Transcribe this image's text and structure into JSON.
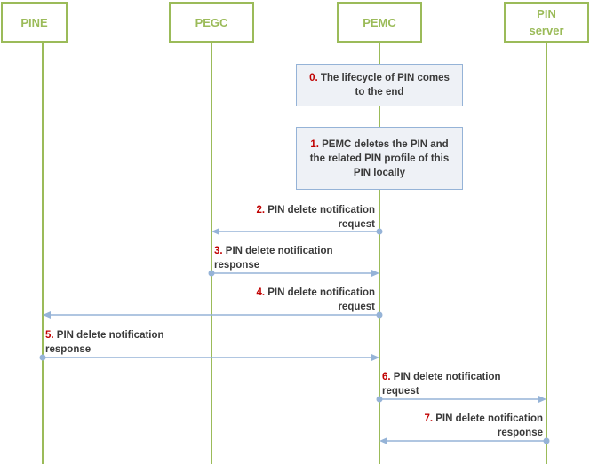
{
  "entities": [
    {
      "name": "PINE"
    },
    {
      "name": "PEGC"
    },
    {
      "name": "PEMC"
    },
    {
      "name": "PIN\nserver"
    }
  ],
  "notes": [
    {
      "num": "0.",
      "text": " The lifecycle of PIN comes to the end"
    },
    {
      "num": "1.",
      "text": " PEMC deletes the PIN and the related PIN profile of this PIN locally"
    }
  ],
  "messages": [
    {
      "num": "2.",
      "line1": " PIN delete notification",
      "line2": "request",
      "from": "PEMC",
      "to": "PEGC"
    },
    {
      "num": "3.",
      "line1": " PIN delete notification",
      "line2": "response",
      "from": "PEGC",
      "to": "PEMC"
    },
    {
      "num": "4.",
      "line1": " PIN delete notification",
      "line2": "request",
      "from": "PEMC",
      "to": "PINE"
    },
    {
      "num": "5.",
      "line1": " PIN delete notification",
      "line2": "response",
      "from": "PINE",
      "to": "PEMC"
    },
    {
      "num": "6.",
      "line1": " PIN delete notification",
      "line2": "request",
      "from": "PEMC",
      "to": "PIN server"
    },
    {
      "num": "7.",
      "line1": " PIN delete notification",
      "line2": "response",
      "from": "PIN server",
      "to": "PEMC"
    }
  ],
  "colors": {
    "entity": "#9bbb59",
    "arrow": "#95b3d7",
    "step_number": "#c00000",
    "note_fill": "#eef1f6"
  }
}
